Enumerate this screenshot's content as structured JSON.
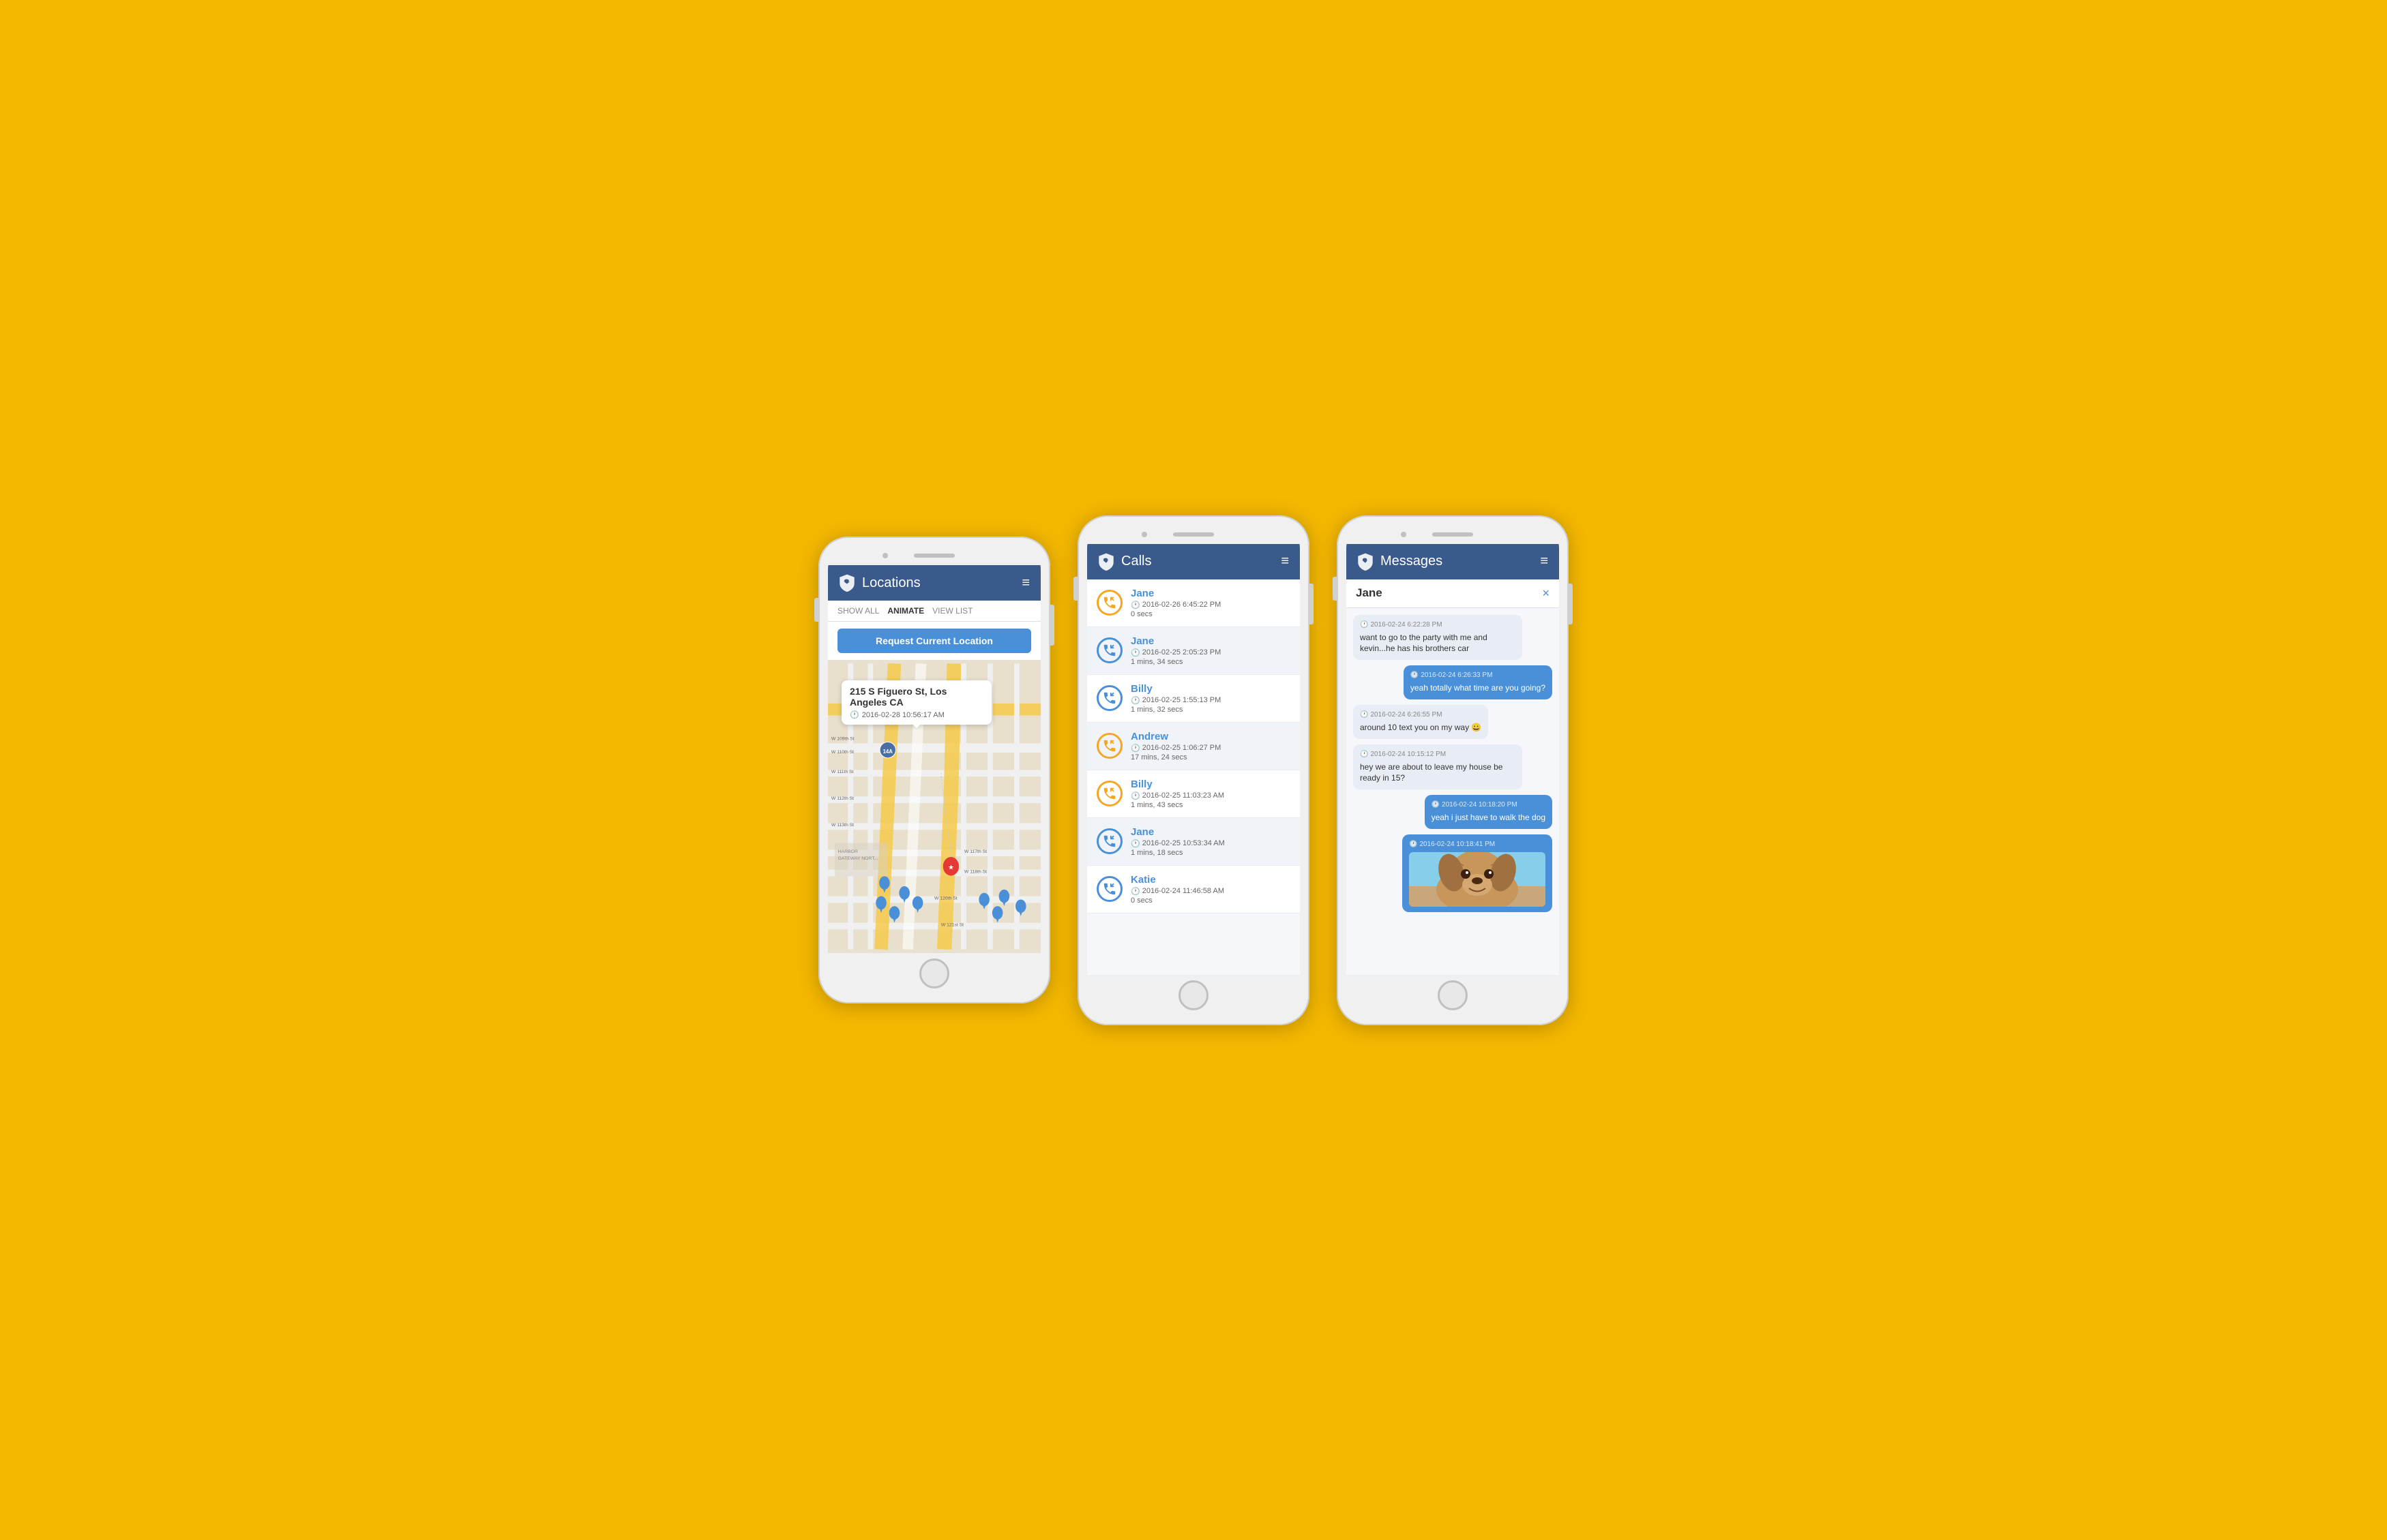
{
  "background_color": "#F5B800",
  "phones": [
    {
      "id": "locations",
      "header": {
        "title": "Locations",
        "icon": "shield-dog-icon",
        "menu_icon": "≡"
      },
      "filter_bar": {
        "items": [
          {
            "label": "SHOW ALL",
            "active": false
          },
          {
            "label": "ANIMATE",
            "active": true
          },
          {
            "label": "VIEW LIST",
            "active": false
          }
        ]
      },
      "request_button": "Request Current Location",
      "map": {
        "popup_address": "215 S Figuero St, Los Angeles CA",
        "popup_time": "2016-02-28 10:56:17 AM"
      }
    },
    {
      "id": "calls",
      "header": {
        "title": "Calls",
        "icon": "shield-dog-icon",
        "menu_icon": "≡"
      },
      "calls": [
        {
          "name": "Jane",
          "time": "2016-02-26 6:45:22 PM",
          "duration": "0 secs",
          "type": "outgoing"
        },
        {
          "name": "Jane",
          "time": "2016-02-25 2:05:23 PM",
          "duration": "1 mins, 34 secs",
          "type": "incoming"
        },
        {
          "name": "Billy",
          "time": "2016-02-25 1:55:13 PM",
          "duration": "1 mins, 32 secs",
          "type": "incoming"
        },
        {
          "name": "Andrew",
          "time": "2016-02-25 1:06:27 PM",
          "duration": "17 mins, 24 secs",
          "type": "outgoing"
        },
        {
          "name": "Billy",
          "time": "2016-02-25 11:03:23 AM",
          "duration": "1 mins, 43 secs",
          "type": "outgoing"
        },
        {
          "name": "Jane",
          "time": "2016-02-25 10:53:34 AM",
          "duration": "1 mins, 18 secs",
          "type": "incoming"
        },
        {
          "name": "Katie",
          "time": "2016-02-24 11:46:58 AM",
          "duration": "0 secs",
          "type": "incoming"
        }
      ]
    },
    {
      "id": "messages",
      "header": {
        "title": "Messages",
        "icon": "shield-dog-icon",
        "menu_icon": "≡"
      },
      "contact": "Jane",
      "close_button": "×",
      "messages": [
        {
          "type": "received",
          "time": "2016-02-24 6:22:28 PM",
          "text": "want to go to the party with me and kevin...he has his brothers car"
        },
        {
          "type": "sent",
          "time": "2016-02-24 6:26:33 PM",
          "text": "yeah totally what time are you going?"
        },
        {
          "type": "received",
          "time": "2016-02-24 6:26:55 PM",
          "text": "around 10 text you on my way 😀"
        },
        {
          "type": "received",
          "time": "2016-02-24 10:15:12 PM",
          "text": "hey we are about to leave my house be ready in 15?"
        },
        {
          "type": "sent",
          "time": "2016-02-24 10:18:20 PM",
          "text": "yeah i just have to walk the dog"
        },
        {
          "type": "sent",
          "time": "2016-02-24 10:18:41 PM",
          "text": "",
          "has_image": true
        }
      ]
    }
  ]
}
